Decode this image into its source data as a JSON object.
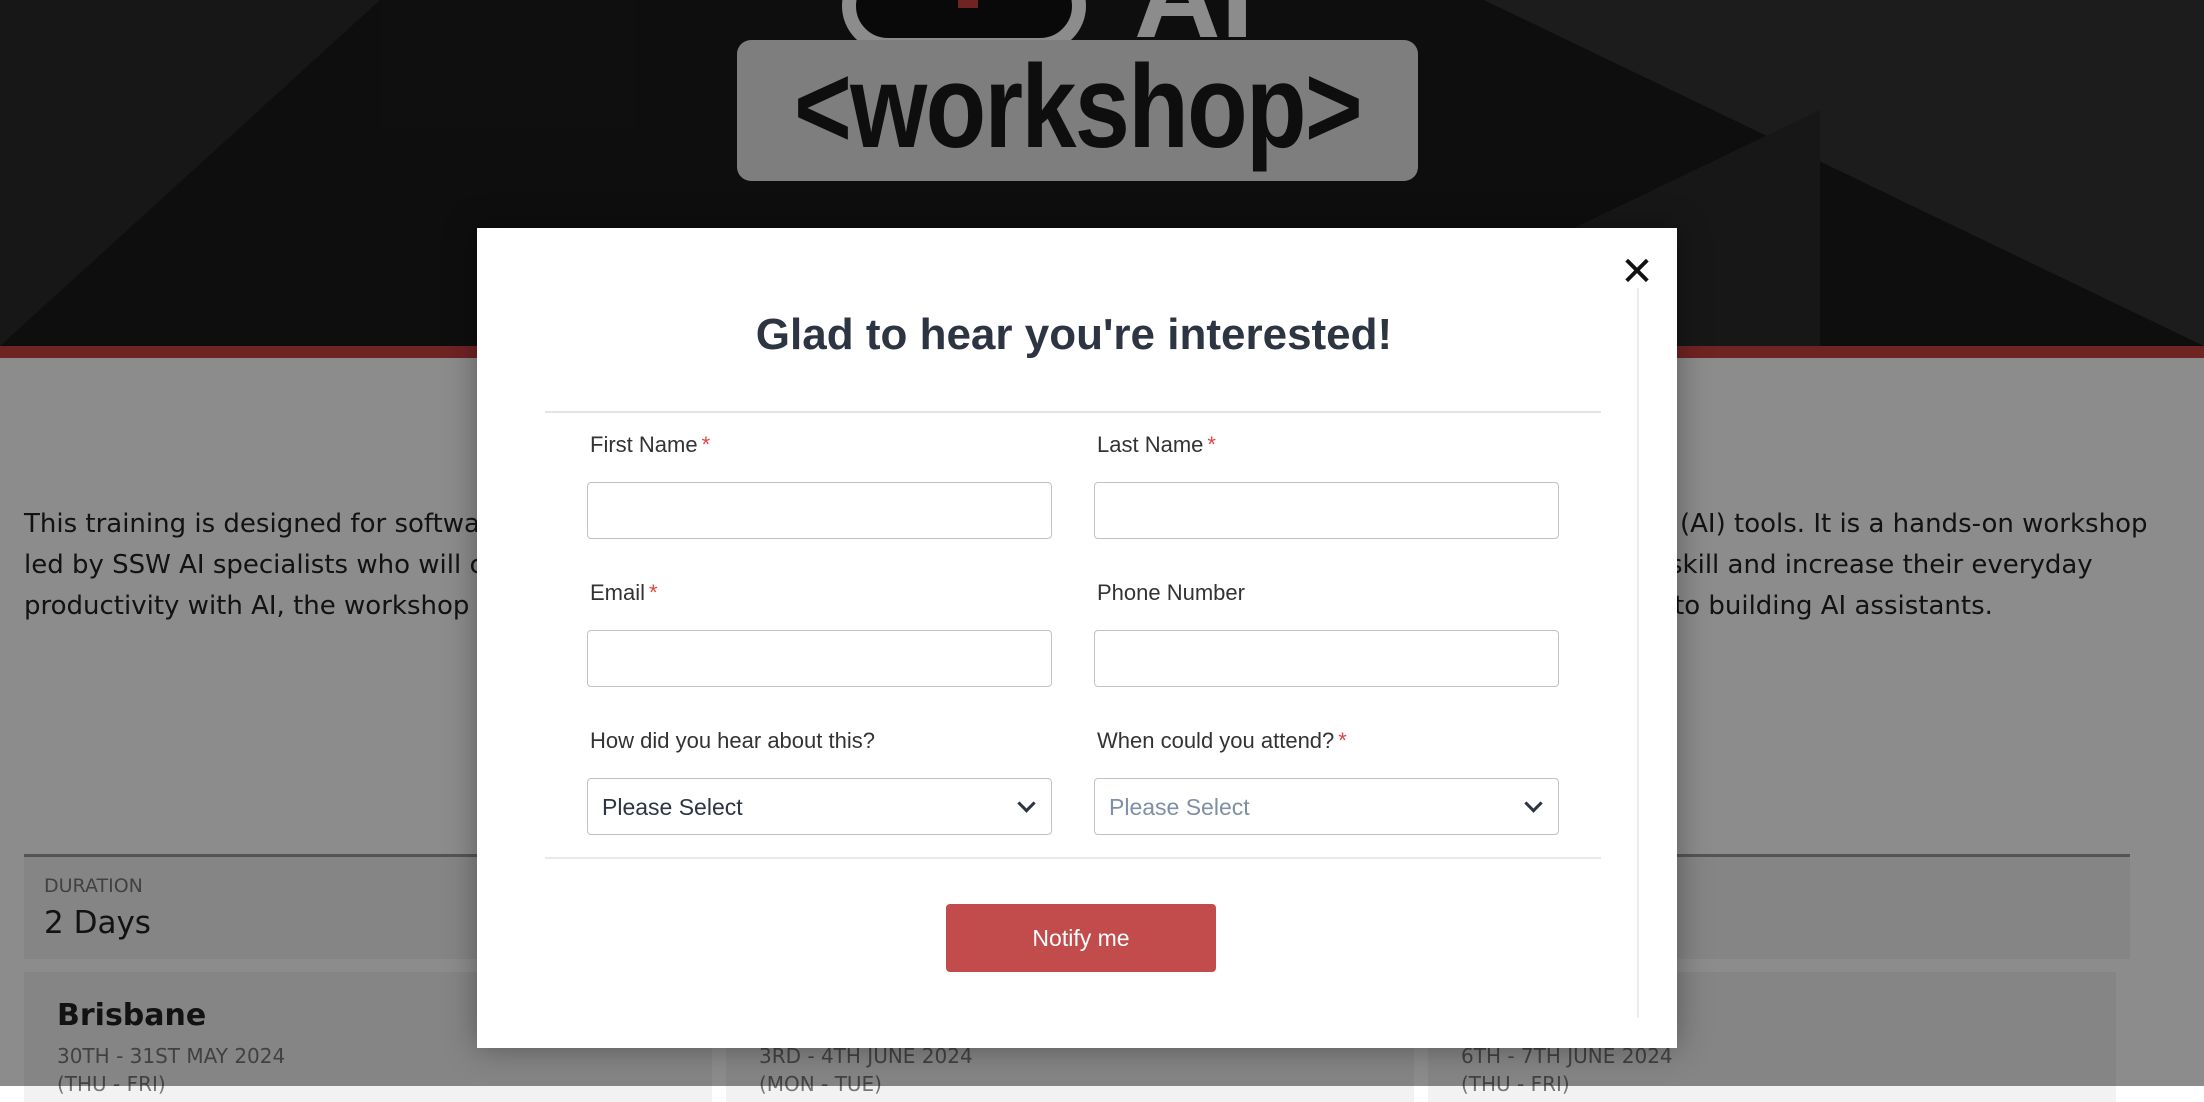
{
  "hero": {
    "logo_text": "<workshop>",
    "logo_partial": "AI"
  },
  "intro": {
    "line1_left": "This training is designed for software",
    "line1_right": "(AI) tools. It is a hands-on workshop",
    "line2_left": "led by SSW AI specialists who will co",
    "line2_right": "skill and increase their everyday",
    "line3_left": "productivity with AI, the workshop in",
    "line3_right": "to building AI assistants."
  },
  "duration": {
    "label": "DURATION",
    "value": "2 Days"
  },
  "locations": [
    {
      "city": "Brisbane",
      "date": "30TH - 31ST MAY 2024",
      "days": "(THU - FRI)"
    },
    {
      "city": "",
      "date": "3RD - 4TH JUNE 2024",
      "days": "(MON - TUE)"
    },
    {
      "city": "",
      "date": "6TH - 7TH JUNE 2024",
      "days": "(THU - FRI)"
    }
  ],
  "modal": {
    "close_glyph": "✕",
    "title": "Glad to hear you're interested!",
    "fields": {
      "first_name": {
        "label": "First Name",
        "required": "*",
        "value": ""
      },
      "last_name": {
        "label": "Last Name",
        "required": "*",
        "value": ""
      },
      "email": {
        "label": "Email",
        "required": "*",
        "value": ""
      },
      "phone": {
        "label": "Phone Number",
        "value": ""
      },
      "hear_about": {
        "label": "How did you hear about this?",
        "selected": "Please Select"
      },
      "attend_when": {
        "label": "When could you attend?",
        "required": "*",
        "selected": "Please Select"
      }
    },
    "submit_label": "Notify me"
  },
  "colors": {
    "accent_red": "#cc4141",
    "button_red": "#c24b4b",
    "title_color": "#2d3442"
  }
}
